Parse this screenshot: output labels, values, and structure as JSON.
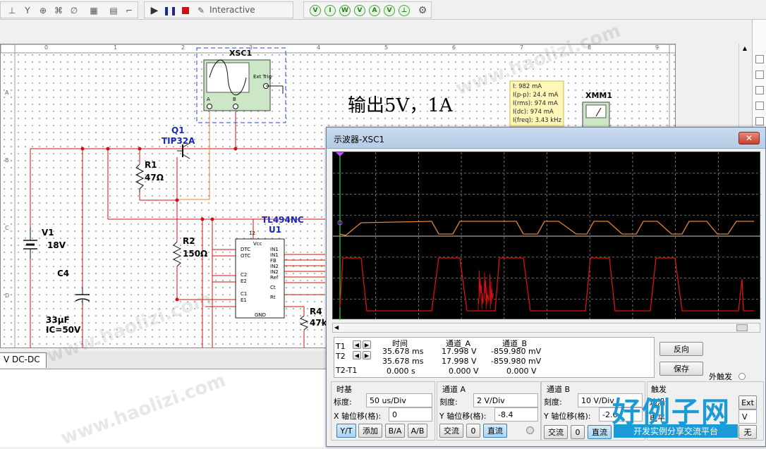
{
  "toolbar": {
    "interactive_label": "Interactive"
  },
  "schematic": {
    "col_labels": [
      "0",
      "1",
      "2",
      "3",
      "4",
      "5",
      "6",
      "7",
      "8",
      "9"
    ],
    "row_labels": [
      "A",
      "B",
      "C",
      "D"
    ],
    "scope_ref": "XSC1",
    "scope_ext_trig": "Ext Trig",
    "scope_a": "A",
    "scope_b": "B",
    "title_text": "输出5V，1A",
    "ammeter_lines": [
      "I: 982 mA",
      "I(p-p): 24.4 mA",
      "I(rms): 974 mA",
      "I(dc): 974 mA",
      "I(freq): 3.43 kHz"
    ],
    "xmm_ref": "XMM1",
    "q1_ref": "Q1",
    "q1_part": "TIP32A",
    "r1_ref": "R1",
    "r1_val": "47Ω",
    "r2_ref": "R2",
    "r2_val": "150Ω",
    "r4_ref": "R4",
    "r4_val": "47k",
    "v1_ref": "V1",
    "v1_val": "18V",
    "c4_ref": "C4",
    "c4_val1": "33µF",
    "c4_val2": "IC=50V",
    "u1_part": "TL494NC",
    "u1_ref": "U1",
    "u1_pins_left": [
      "DTC",
      "OTC",
      "C2",
      "E2",
      "C1",
      "E1"
    ],
    "u1_pins_right": [
      "IN1",
      "IN1",
      "FB",
      "IN2",
      "IN2",
      "Ref",
      "Ct",
      "Rt"
    ],
    "u1_vcc": "Vcc",
    "u1_gnd": "GND",
    "u1_pin12": "12"
  },
  "tabs": {
    "active": "V DC-DC"
  },
  "scope": {
    "title": "示波器-XSC1",
    "close_label": "✕",
    "readout": {
      "headers": [
        "时间",
        "通道_A",
        "通道_B"
      ],
      "t1_label": "T1",
      "t2_label": "T2",
      "t21_label": "T2-T1",
      "rows": [
        [
          "35.678 ms",
          "17.998 V",
          "-859.980 mV"
        ],
        [
          "35.678 ms",
          "17.998 V",
          "-859.980 mV"
        ],
        [
          "0.000 s",
          "0.000 V",
          "0.000 V"
        ]
      ]
    },
    "reverse_btn": "反向",
    "save_btn": "保存",
    "ext_trig": "外触发",
    "timebase": {
      "title": "时基",
      "scale_label": "标度:",
      "scale_value": "50 us/Div",
      "xpos_label": "X 轴位移(格):",
      "xpos_value": "0",
      "modes": [
        "Y/T",
        "添加",
        "B/A",
        "A/B"
      ]
    },
    "channel_a": {
      "title": "通道 A",
      "scale_label": "刻度:",
      "scale_value": "2 V/Div",
      "ypos_label": "Y 轴位移(格):",
      "ypos_value": "-8.4",
      "coupling": [
        "交流",
        "0",
        "直流"
      ]
    },
    "channel_b": {
      "title": "通道 B",
      "scale_label": "刻度:",
      "scale_value": "10 V/Div",
      "ypos_label": "Y 轴位移(格):",
      "ypos_value": "-2.6",
      "coupling": [
        "交流",
        "0",
        "直流"
      ]
    },
    "trigger": {
      "title": "触发",
      "level_label": "电平:",
      "ext_btn": "Ext",
      "unit": "V",
      "mode_none": "无",
      "edge_label": "边沿:"
    },
    "colors": {
      "trace_a": "#e8842a",
      "trace_b": "#e01010",
      "grid": "#8a8a8a"
    }
  },
  "watermark": {
    "text": "www.haolizi.com",
    "logo": "好例子网",
    "logo_sub": "开发实例分享交流平台"
  }
}
